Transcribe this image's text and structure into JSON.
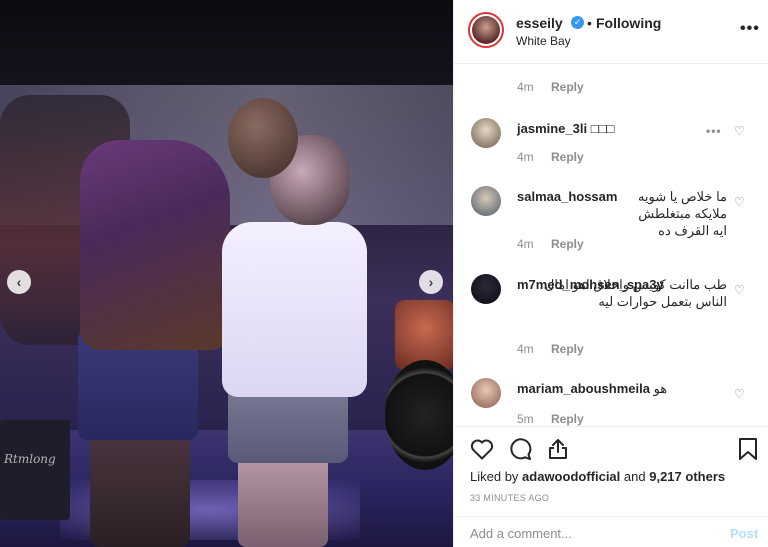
{
  "post": {
    "username": "esseily",
    "following_label": "Following",
    "location": "White Bay",
    "more_label": "•••"
  },
  "photo": {
    "watermark": "Rtmlong"
  },
  "comments": [
    {
      "username": "",
      "text": "",
      "time": "4m",
      "reply_label": "Reply"
    },
    {
      "username": "jasmine_3li",
      "text": "□□□",
      "time": "4m",
      "reply_label": "Reply"
    },
    {
      "username": "salmaa_hossam",
      "text": "ما خلاص يا شويه ملايكه مبتغلطش ايه القرف ده",
      "time": "4m",
      "reply_label": "Reply"
    },
    {
      "username": "m7med_mohsen_spa3y",
      "text": "طب ماانت كويس واخلاق اهو امال الناس بتعمل حوارات ليه",
      "time": "4m",
      "reply_label": "Reply"
    },
    {
      "username": "mariam_aboushmeila",
      "text": "هو",
      "time": "5m",
      "reply_label": "Reply"
    }
  ],
  "likes": {
    "prefix": "Liked by",
    "user": "adawoodofficial",
    "middle": "and",
    "count": "9,217 others"
  },
  "timeago": "33 MINUTES AGO",
  "add_comment": {
    "placeholder": "Add a comment...",
    "post_label": "Post"
  },
  "icons": {
    "like": "heart-icon",
    "comment": "comment-icon",
    "share": "share-icon",
    "save": "bookmark-icon"
  },
  "colors": {
    "verified": "#3897f0",
    "muted": "#8e8e8e",
    "text": "#262626",
    "post_disabled": "#b2dffc"
  }
}
